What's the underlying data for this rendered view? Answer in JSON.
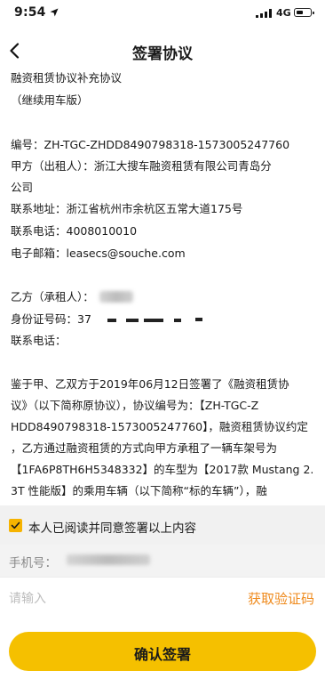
{
  "status_bar": {
    "time": "9:54",
    "network": "4G"
  },
  "nav": {
    "title": "签署协议",
    "back_icon": "chevron-left-icon"
  },
  "document": {
    "lines": [
      "融资租赁协议补充协议",
      "（继续用车版）",
      "编号：ZH-TGC-ZHDD8490798318-1573005247760",
      "甲方（出租人）：浙江大搜车融资租赁有限公司青岛分",
      "公司",
      "联系地址：浙江省杭州市余杭区五常大道175号",
      "联系电话：4008010010",
      "电子邮箱：leasecs@souche.com",
      "乙方（承租人）：",
      "身份证号码：37",
      "联系电话：",
      "鉴于甲、乙双方于2019年06月12日签署了《融资租赁协",
      "议》（以下简称原协议），协议编号为：【ZH-TGC-Z",
      "HDD8490798318-1573005247760】，融资租赁协议约定",
      "，乙方通过融资租赁的方式向甲方承租了一辆车架号为",
      "【1FA6P8TH6H5348332】的车型为【2017款 Mustang 2.",
      "3T 性能版】的乘用车辆（以下简称“标的车辆”），融"
    ]
  },
  "consent": {
    "checked": true,
    "label": "本人已阅读并同意签署以上内容"
  },
  "phone": {
    "label": "手机号："
  },
  "code": {
    "placeholder": "请输入",
    "get_code_label": "获取验证码"
  },
  "confirm": {
    "label": "确认签署"
  },
  "colors": {
    "accent": "#f5c000",
    "link": "#ef8a1c",
    "checkbox": "#f6b300"
  }
}
